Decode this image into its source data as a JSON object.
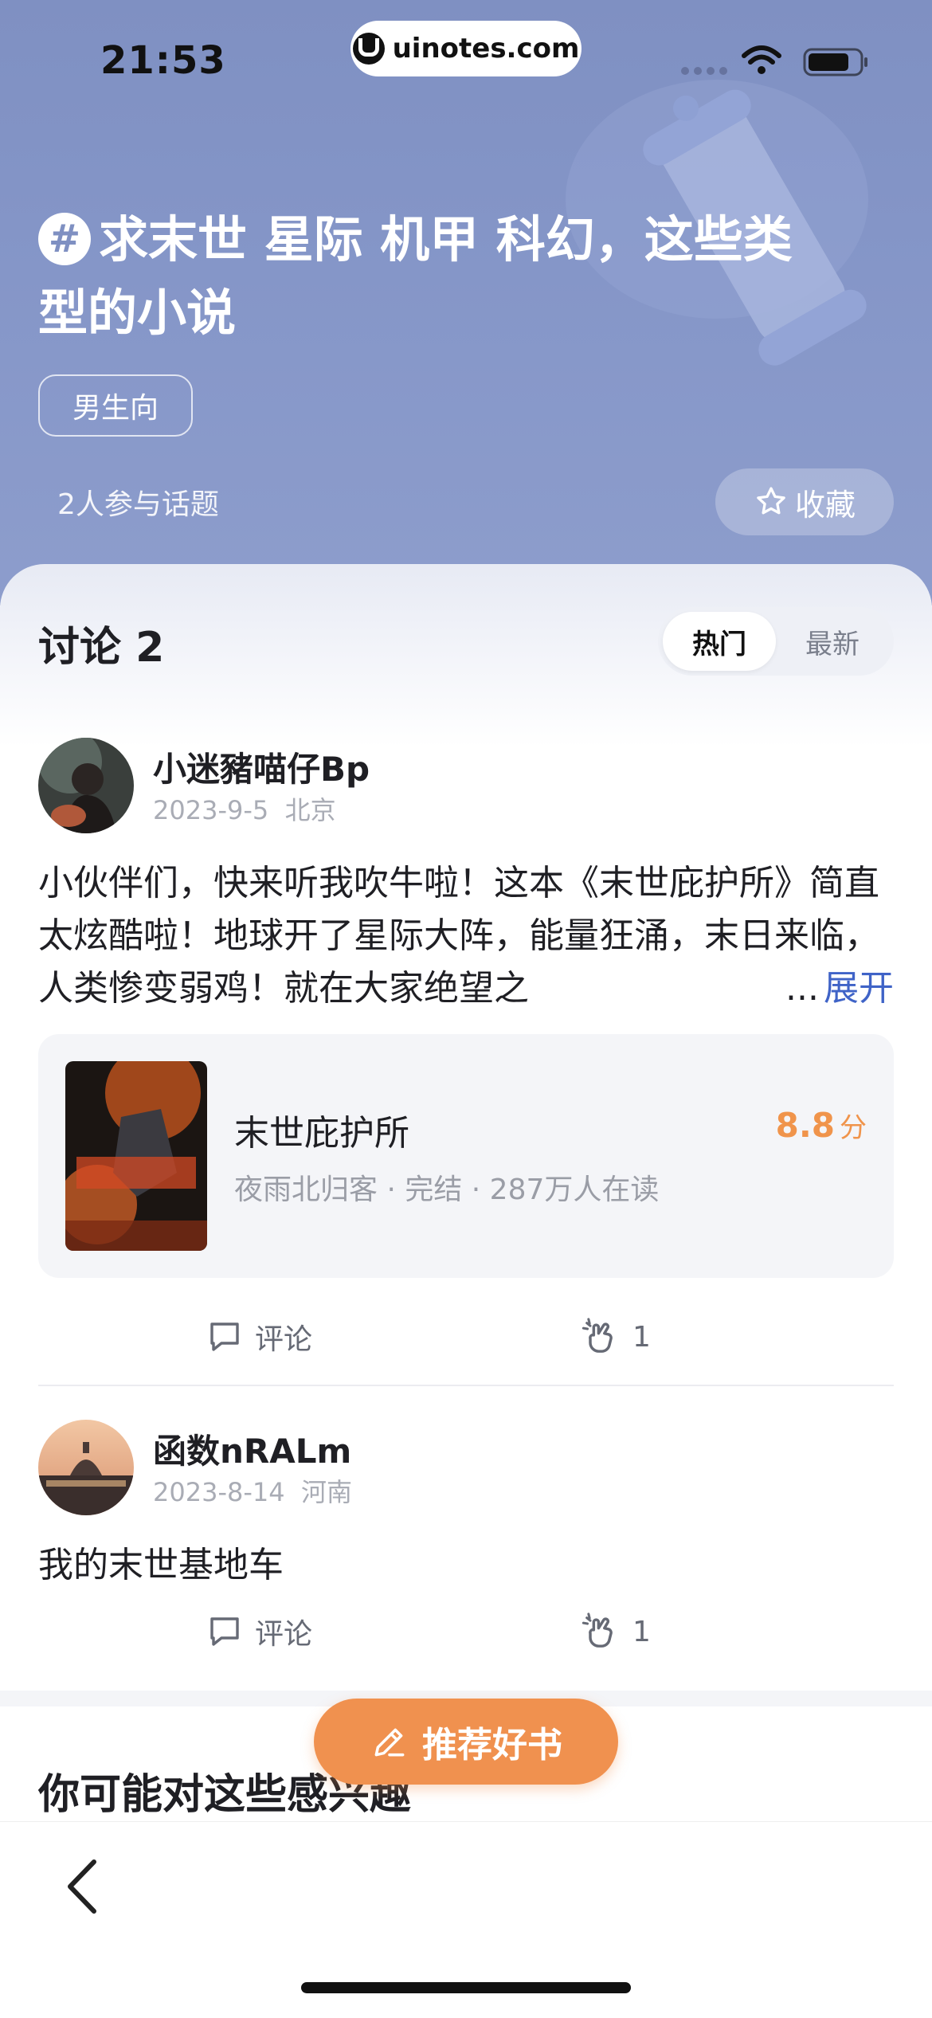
{
  "status_bar": {
    "time": "21:53",
    "url": "uinotes.com"
  },
  "topic": {
    "title": "求末世 星际 机甲 科幻，这些类型的小说",
    "tag": "男生向",
    "participants": "2人参与话题",
    "favorite_label": "收藏"
  },
  "discussion": {
    "title": "讨论 2",
    "sort_tabs": [
      {
        "label": "热门",
        "selected": true
      },
      {
        "label": "最新",
        "selected": false
      }
    ]
  },
  "posts": [
    {
      "username": "小迷豬喵仔Bp",
      "date": "2023-9-5",
      "location": "北京",
      "text": "小伙伴们，快来听我吹牛啦！这本《末世庇护所》简直太炫酷啦！地球开了星际大阵，能量狂涌，末日来临，人类惨变弱鸡！就在大家绝望之",
      "expand_label": "展开",
      "book": {
        "title": "末世庇护所",
        "meta": "夜雨北归客 · 完结 · 287万人在读",
        "score": "8.8",
        "score_unit": "分"
      },
      "comment_label": "评论",
      "likes": "1"
    },
    {
      "username": "函数nRALm",
      "date": "2023-8-14",
      "location": "河南",
      "text": "我的末世基地车",
      "comment_label": "评论",
      "likes": "1"
    }
  ],
  "interest_title": "你可能对这些感兴趣",
  "recommend_button": "推荐好书",
  "colors": {
    "hero_bg": "#8293c5",
    "accent_orange": "#f0914f",
    "link_blue": "#3f63c7"
  }
}
